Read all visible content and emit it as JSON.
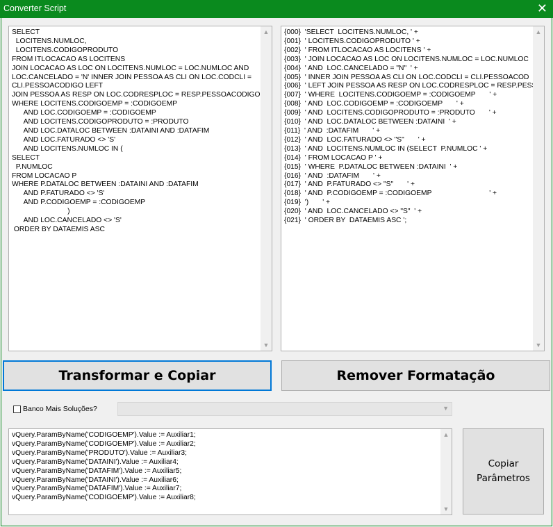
{
  "window": {
    "title": "Converter Script"
  },
  "left_editor": {
    "text": "SELECT\n  LOCITENS.NUMLOC,\n  LOCITENS.CODIGOPRODUTO\nFROM ITLOCACAO AS LOCITENS\nJOIN LOCACAO AS LOC ON LOCITENS.NUMLOC = LOC.NUMLOC AND\nLOC.CANCELADO = 'N' INNER JOIN PESSOA AS CLI ON LOC.CODCLI =\nCLI.PESSOACODIGO LEFT\nJOIN PESSOA AS RESP ON LOC.CODRESPLOC = RESP.PESSOACODIGO\nWHERE LOCITENS.CODIGOEMP = :CODIGOEMP\n      AND LOC.CODIGOEMP = :CODIGOEMP\n      AND LOCITENS.CODIGOPRODUTO = :PRODUTO\n      AND LOC.DATALOC BETWEEN :DATAINI AND :DATAFIM\n      AND LOC.FATURADO <> 'S'\n      AND LOCITENS.NUMLOC IN (\nSELECT\n  P.NUMLOC\nFROM LOCACAO P\nWHERE P.DATALOC BETWEEN :DATAINI AND :DATAFIM\n      AND P.FATURADO <> 'S'\n      AND P.CODIGOEMP = :CODIGOEMP\n                            )\n      AND LOC.CANCELADO <> 'S'\n ORDER BY DATAEMIS ASC"
  },
  "right_editor": {
    "text": "{000}  'SELECT  LOCITENS.NUMLOC, ' +\n{001}  ' LOCITENS.CODIGOPRODUTO ' +\n{002}  ' FROM ITLOCACAO AS LOCITENS ' +\n{003}  ' JOIN LOCACAO AS LOC ON LOCITENS.NUMLOC = LOC.NUMLOC\n{004}  ' AND  LOC.CANCELADO = \"N\"  ' +\n{005}  ' INNER JOIN PESSOA AS CLI ON LOC.CODCLI = CLI.PESSOACOD\n{006}  ' LEFT JOIN PESSOA AS RESP ON LOC.CODRESPLOC = RESP.PESS\n{007}  ' WHERE  LOCITENS.CODIGOEMP = :CODIGOEMP       ' +\n{008}  ' AND  LOC.CODIGOEMP = :CODIGOEMP       ' +\n{009}  ' AND  LOCITENS.CODIGOPRODUTO = :PRODUTO       ' +\n{010}  ' AND  LOC.DATALOC BETWEEN :DATAINI  ' +\n{011}  ' AND  :DATAFIM       ' +\n{012}  ' AND  LOC.FATURADO <> \"S\"       ' +\n{013}  ' AND  LOCITENS.NUMLOC IN (SELECT  P.NUMLOC ' +\n{014}  ' FROM LOCACAO P ' +\n{015}  ' WHERE  P.DATALOC BETWEEN :DATAINI  ' +\n{016}  ' AND  :DATAFIM       ' +\n{017}  ' AND  P.FATURADO <> \"S\"       ' +\n{018}  ' AND  P.CODIGOEMP = :CODIGOEMP                             ' +\n{019}  ')       ' +\n{020}  ' AND  LOC.CANCELADO <> \"S\"  ' +\n{021}  ' ORDER BY  DATAEMIS ASC ';"
  },
  "buttons": {
    "transform": "Transformar e Copiar",
    "remove": "Remover Formatação",
    "copy_params": "Copiar\nParâmetros"
  },
  "checkbox": {
    "label": "Banco Mais Soluções?",
    "checked": false
  },
  "combo": {
    "value": ""
  },
  "params_editor": {
    "text": "vQuery.ParamByName('CODIGOEMP').Value := Auxiliar1;\nvQuery.ParamByName('CODIGOEMP').Value := Auxiliar2;\nvQuery.ParamByName('PRODUTO').Value := Auxiliar3;\nvQuery.ParamByName('DATAINI').Value := Auxiliar4;\nvQuery.ParamByName('DATAFIM').Value := Auxiliar5;\nvQuery.ParamByName('DATAINI').Value := Auxiliar6;\nvQuery.ParamByName('DATAFIM').Value := Auxiliar7;\nvQuery.ParamByName('CODIGOEMP').Value := Auxiliar8;"
  },
  "icons": {
    "close": "close-icon",
    "scroll_up": "scroll-up-arrow-icon",
    "scroll_down": "scroll-down-arrow-icon",
    "dropdown": "chevron-down-icon"
  },
  "colors": {
    "titlebar": "#0a8a1e",
    "focus_border": "#0078d7"
  }
}
